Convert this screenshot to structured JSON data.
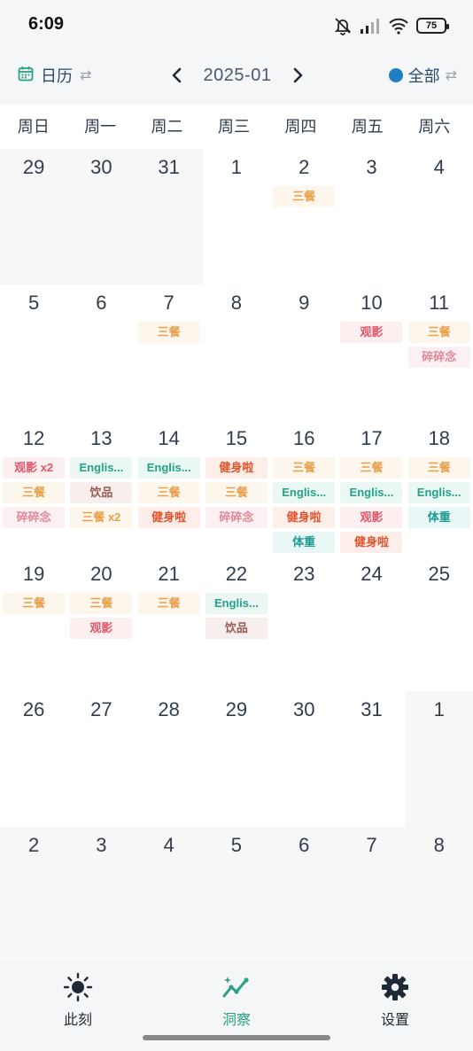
{
  "status_bar": {
    "time": "6:09",
    "battery": "75"
  },
  "toolbar": {
    "view_label": "日历",
    "month": "2025-01",
    "filter_label": "全部",
    "filter_color": "#1e7fc4",
    "accent_color": "#2aa084"
  },
  "weekdays": [
    "周日",
    "周一",
    "周二",
    "周三",
    "周四",
    "周五",
    "周六"
  ],
  "weeks": [
    [
      {
        "day": "29",
        "other": true,
        "tags": []
      },
      {
        "day": "30",
        "other": true,
        "tags": []
      },
      {
        "day": "31",
        "other": true,
        "tags": []
      },
      {
        "day": "1",
        "tags": []
      },
      {
        "day": "2",
        "tags": [
          {
            "label": "三餐",
            "kind": "meal"
          }
        ]
      },
      {
        "day": "3",
        "tags": []
      },
      {
        "day": "4",
        "tags": []
      }
    ],
    [
      {
        "day": "5",
        "tags": []
      },
      {
        "day": "6",
        "tags": []
      },
      {
        "day": "7",
        "tags": [
          {
            "label": "三餐",
            "kind": "meal"
          }
        ]
      },
      {
        "day": "8",
        "tags": []
      },
      {
        "day": "9",
        "tags": []
      },
      {
        "day": "10",
        "tags": [
          {
            "label": "观影",
            "kind": "movie"
          }
        ]
      },
      {
        "day": "11",
        "tags": [
          {
            "label": "三餐",
            "kind": "meal"
          },
          {
            "label": "碎碎念",
            "kind": "mutter"
          }
        ]
      }
    ],
    [
      {
        "day": "12",
        "tags": [
          {
            "label": "观影 x2",
            "kind": "movie"
          },
          {
            "label": "三餐",
            "kind": "meal"
          },
          {
            "label": "碎碎念",
            "kind": "mutter"
          }
        ]
      },
      {
        "day": "13",
        "tags": [
          {
            "label": "Englis...",
            "kind": "english"
          },
          {
            "label": "饮品",
            "kind": "drink"
          },
          {
            "label": "三餐 x2",
            "kind": "meal"
          }
        ]
      },
      {
        "day": "14",
        "tags": [
          {
            "label": "Englis...",
            "kind": "english"
          },
          {
            "label": "三餐",
            "kind": "meal"
          },
          {
            "label": "健身啦",
            "kind": "gym"
          }
        ]
      },
      {
        "day": "15",
        "tags": [
          {
            "label": "健身啦",
            "kind": "gym"
          },
          {
            "label": "三餐",
            "kind": "meal"
          },
          {
            "label": "碎碎念",
            "kind": "mutter"
          }
        ]
      },
      {
        "day": "16",
        "tags": [
          {
            "label": "三餐",
            "kind": "meal"
          },
          {
            "label": "Englis...",
            "kind": "english"
          },
          {
            "label": "健身啦",
            "kind": "gym"
          },
          {
            "label": "体重",
            "kind": "weight"
          }
        ]
      },
      {
        "day": "17",
        "tags": [
          {
            "label": "三餐",
            "kind": "meal"
          },
          {
            "label": "Englis...",
            "kind": "english"
          },
          {
            "label": "观影",
            "kind": "movie"
          },
          {
            "label": "健身啦",
            "kind": "gym"
          }
        ]
      },
      {
        "day": "18",
        "tags": [
          {
            "label": "三餐",
            "kind": "meal"
          },
          {
            "label": "Englis...",
            "kind": "english"
          },
          {
            "label": "体重",
            "kind": "weight"
          }
        ]
      }
    ],
    [
      {
        "day": "19",
        "tags": [
          {
            "label": "三餐",
            "kind": "meal"
          }
        ]
      },
      {
        "day": "20",
        "tags": [
          {
            "label": "三餐",
            "kind": "meal"
          },
          {
            "label": "观影",
            "kind": "movie"
          }
        ]
      },
      {
        "day": "21",
        "tags": [
          {
            "label": "三餐",
            "kind": "meal"
          }
        ]
      },
      {
        "day": "22",
        "tags": [
          {
            "label": "Englis...",
            "kind": "english"
          },
          {
            "label": "饮品",
            "kind": "drink"
          }
        ]
      },
      {
        "day": "23",
        "tags": []
      },
      {
        "day": "24",
        "tags": []
      },
      {
        "day": "25",
        "tags": []
      }
    ],
    [
      {
        "day": "26",
        "tags": []
      },
      {
        "day": "27",
        "tags": []
      },
      {
        "day": "28",
        "tags": []
      },
      {
        "day": "29",
        "tags": []
      },
      {
        "day": "30",
        "tags": []
      },
      {
        "day": "31",
        "tags": []
      },
      {
        "day": "1",
        "other": true,
        "tags": []
      }
    ],
    [
      {
        "day": "2",
        "other": true,
        "tags": []
      },
      {
        "day": "3",
        "other": true,
        "tags": []
      },
      {
        "day": "4",
        "other": true,
        "tags": []
      },
      {
        "day": "5",
        "other": true,
        "tags": []
      },
      {
        "day": "6",
        "other": true,
        "tags": []
      },
      {
        "day": "7",
        "other": true,
        "tags": []
      },
      {
        "day": "8",
        "other": true,
        "tags": []
      }
    ]
  ],
  "bottom_nav": [
    {
      "label": "此刻",
      "icon": "sun-icon",
      "active": false
    },
    {
      "label": "洞察",
      "icon": "insight-icon",
      "active": true
    },
    {
      "label": "设置",
      "icon": "gear-icon",
      "active": false
    }
  ]
}
